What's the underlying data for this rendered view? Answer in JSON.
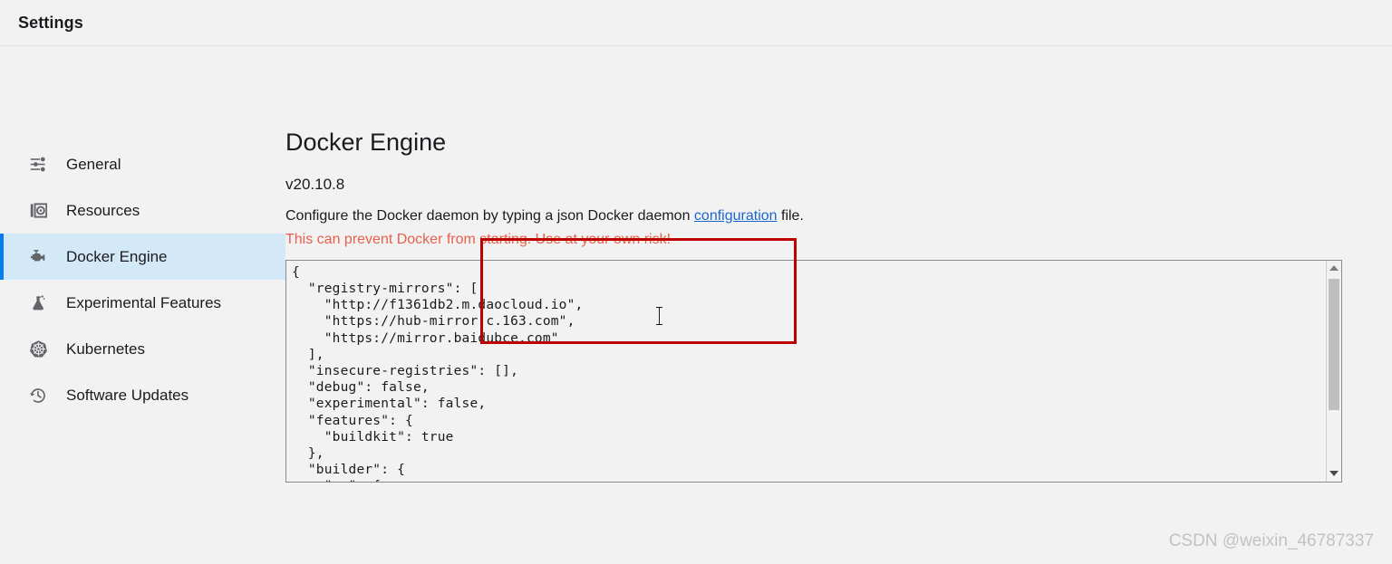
{
  "window": {
    "title": "Settings"
  },
  "sidebar": {
    "items": [
      {
        "label": "General",
        "icon": "sliders-icon",
        "active": false
      },
      {
        "label": "Resources",
        "icon": "resources-icon",
        "active": false
      },
      {
        "label": "Docker Engine",
        "icon": "docker-engine-icon",
        "active": true
      },
      {
        "label": "Experimental Features",
        "icon": "flask-icon",
        "active": false
      },
      {
        "label": "Kubernetes",
        "icon": "kubernetes-icon",
        "active": false
      },
      {
        "label": "Software Updates",
        "icon": "history-clock-icon",
        "active": false
      }
    ]
  },
  "main": {
    "page_title": "Docker Engine",
    "version": "v20.10.8",
    "description_before": "Configure the Docker daemon by typing a json Docker daemon ",
    "description_link": "configuration",
    "description_after": " file.",
    "warning": "This can prevent Docker from starting. Use at your own risk!",
    "editor": {
      "content": "{\n  \"registry-mirrors\": [\n    \"http://f1361db2.m.daocloud.io\",\n    \"https://hub-mirror.c.163.com\",\n    \"https://mirror.baidubce.com\"\n  ],\n  \"insecure-registries\": [],\n  \"debug\": false,\n  \"experimental\": false,\n  \"features\": {\n    \"buildkit\": true\n  },\n  \"builder\": {\n    \"gc\": {",
      "scrollbar": {
        "up_arrow": "scroll-up-arrow",
        "down_arrow": "scroll-down-arrow"
      }
    }
  },
  "annotation": {
    "color": "#bc0000"
  },
  "watermark": {
    "text": "CSDN @weixin_46787337"
  },
  "colors": {
    "accent": "#0b7cec",
    "active_bg": "#d4e9f7",
    "link": "#1a67d2",
    "warning": "#e8604c",
    "page_bg": "#f2f2f3"
  }
}
